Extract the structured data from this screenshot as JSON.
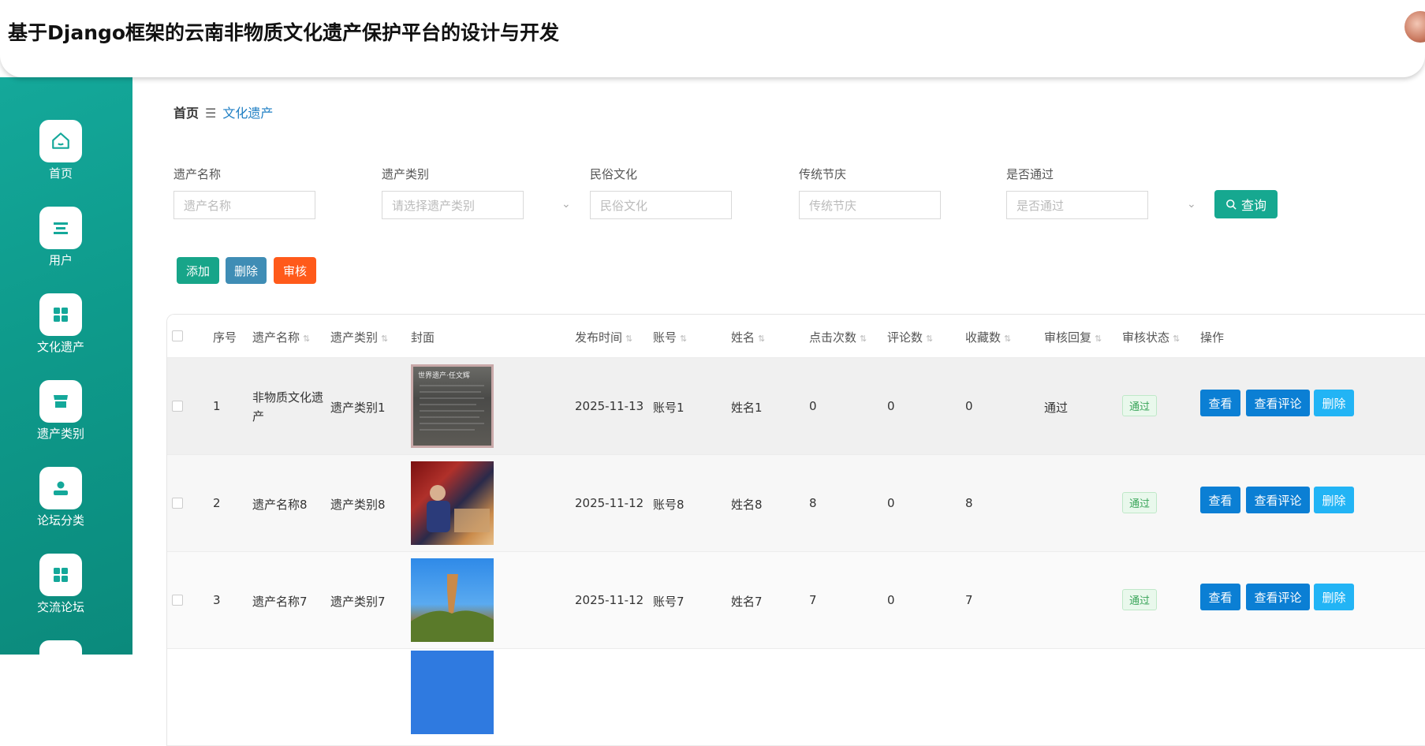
{
  "header": {
    "title": "基于Django框架的云南非物质文化遗产保护平台的设计与开发"
  },
  "sidebar": {
    "items": [
      {
        "label": "首页",
        "icon": "home-icon"
      },
      {
        "label": "用户",
        "icon": "user-list-icon"
      },
      {
        "label": "文化遗产",
        "icon": "grid-icon"
      },
      {
        "label": "遗产类别",
        "icon": "shop-icon"
      },
      {
        "label": "论坛分类",
        "icon": "person-icon"
      },
      {
        "label": "交流论坛",
        "icon": "grid-icon"
      }
    ]
  },
  "breadcrumb": {
    "home": "首页",
    "separator": "☰",
    "current": "文化遗产"
  },
  "filters": {
    "heritage_name": {
      "label": "遗产名称",
      "placeholder": "遗产名称"
    },
    "heritage_type": {
      "label": "遗产类别",
      "placeholder": "请选择遗产类别"
    },
    "folk_culture": {
      "label": "民俗文化",
      "placeholder": "民俗文化"
    },
    "festival": {
      "label": "传统节庆",
      "placeholder": "传统节庆"
    },
    "approved": {
      "label": "是否通过",
      "placeholder": "是否通过"
    },
    "search_button": "查询"
  },
  "actions": {
    "add": "添加",
    "delete": "删除",
    "review": "审核"
  },
  "colors": {
    "primary": "#16a890",
    "sidebar": "#0e9a8b",
    "add": "#17a589",
    "delete": "#3f8db5",
    "review": "#ff5a1a",
    "view": "#0b7fd4",
    "remove": "#22b4f5"
  },
  "table": {
    "headers": [
      "序号",
      "遗产名称",
      "遗产类别",
      "封面",
      "发布时间",
      "账号",
      "姓名",
      "点击次数",
      "评论数",
      "收藏数",
      "审核回复",
      "审核状态",
      "操作"
    ],
    "rows": [
      {
        "index": "1",
        "name_line1": "非物质文化遗",
        "name_line2": "产",
        "type": "遗产类别1",
        "time": "2025-11-13",
        "account": "账号1",
        "person": "姓名1",
        "clicks": "0",
        "comments": "0",
        "favorites": "0",
        "reply": "通过",
        "status": "通过"
      },
      {
        "index": "2",
        "name_line1": "遗产名称8",
        "name_line2": "",
        "type": "遗产类别8",
        "time": "2025-11-12",
        "account": "账号8",
        "person": "姓名8",
        "clicks": "8",
        "comments": "0",
        "favorites": "8",
        "reply": "",
        "status": "通过"
      },
      {
        "index": "3",
        "name_line1": "遗产名称7",
        "name_line2": "",
        "type": "遗产类别7",
        "time": "2025-11-12",
        "account": "账号7",
        "person": "姓名7",
        "clicks": "7",
        "comments": "0",
        "favorites": "7",
        "reply": "",
        "status": "通过"
      }
    ],
    "row_actions": {
      "view": "查看",
      "view_comments": "查看评论",
      "delete": "删除"
    },
    "cover_texts": {
      "row1": "世界遗产·任文辉"
    }
  }
}
